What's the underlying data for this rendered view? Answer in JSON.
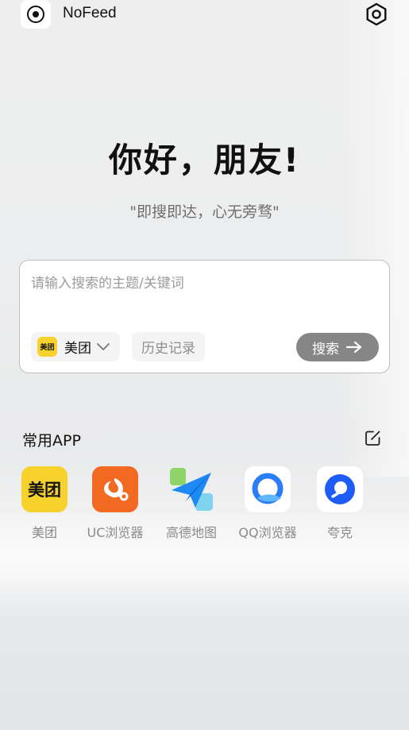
{
  "header": {
    "title": "NoFeed",
    "logo_icon": "target-dot-icon",
    "settings_icon": "hexagon-gear-icon"
  },
  "hero": {
    "greeting": "你好，朋友!",
    "slogan": "\"即搜即达，心无旁骛\""
  },
  "search": {
    "placeholder": "请输入搜索的主题/关键词",
    "value": "",
    "engine": {
      "label": "美团",
      "icon_text": "美团",
      "icon_color": "#F7D22C"
    },
    "history_label": "历史记录",
    "search_label": "搜索",
    "button_color": "#868686"
  },
  "apps_section": {
    "title": "常用APP",
    "edit_icon": "edit-square-icon",
    "apps": [
      {
        "label": "美团",
        "icon": "meituan-icon",
        "icon_text": "美团",
        "color": "#F7D22C"
      },
      {
        "label": "UC浏览器",
        "icon": "uc-squirrel-icon",
        "color": "#F26A22"
      },
      {
        "label": "高德地图",
        "icon": "paper-plane-icon",
        "color": "#1E88F5"
      },
      {
        "label": "QQ浏览器",
        "icon": "qq-browser-icon",
        "color": "#2A7DF6"
      },
      {
        "label": "夸克",
        "icon": "quark-icon",
        "color": "#1E5BF7"
      }
    ]
  }
}
